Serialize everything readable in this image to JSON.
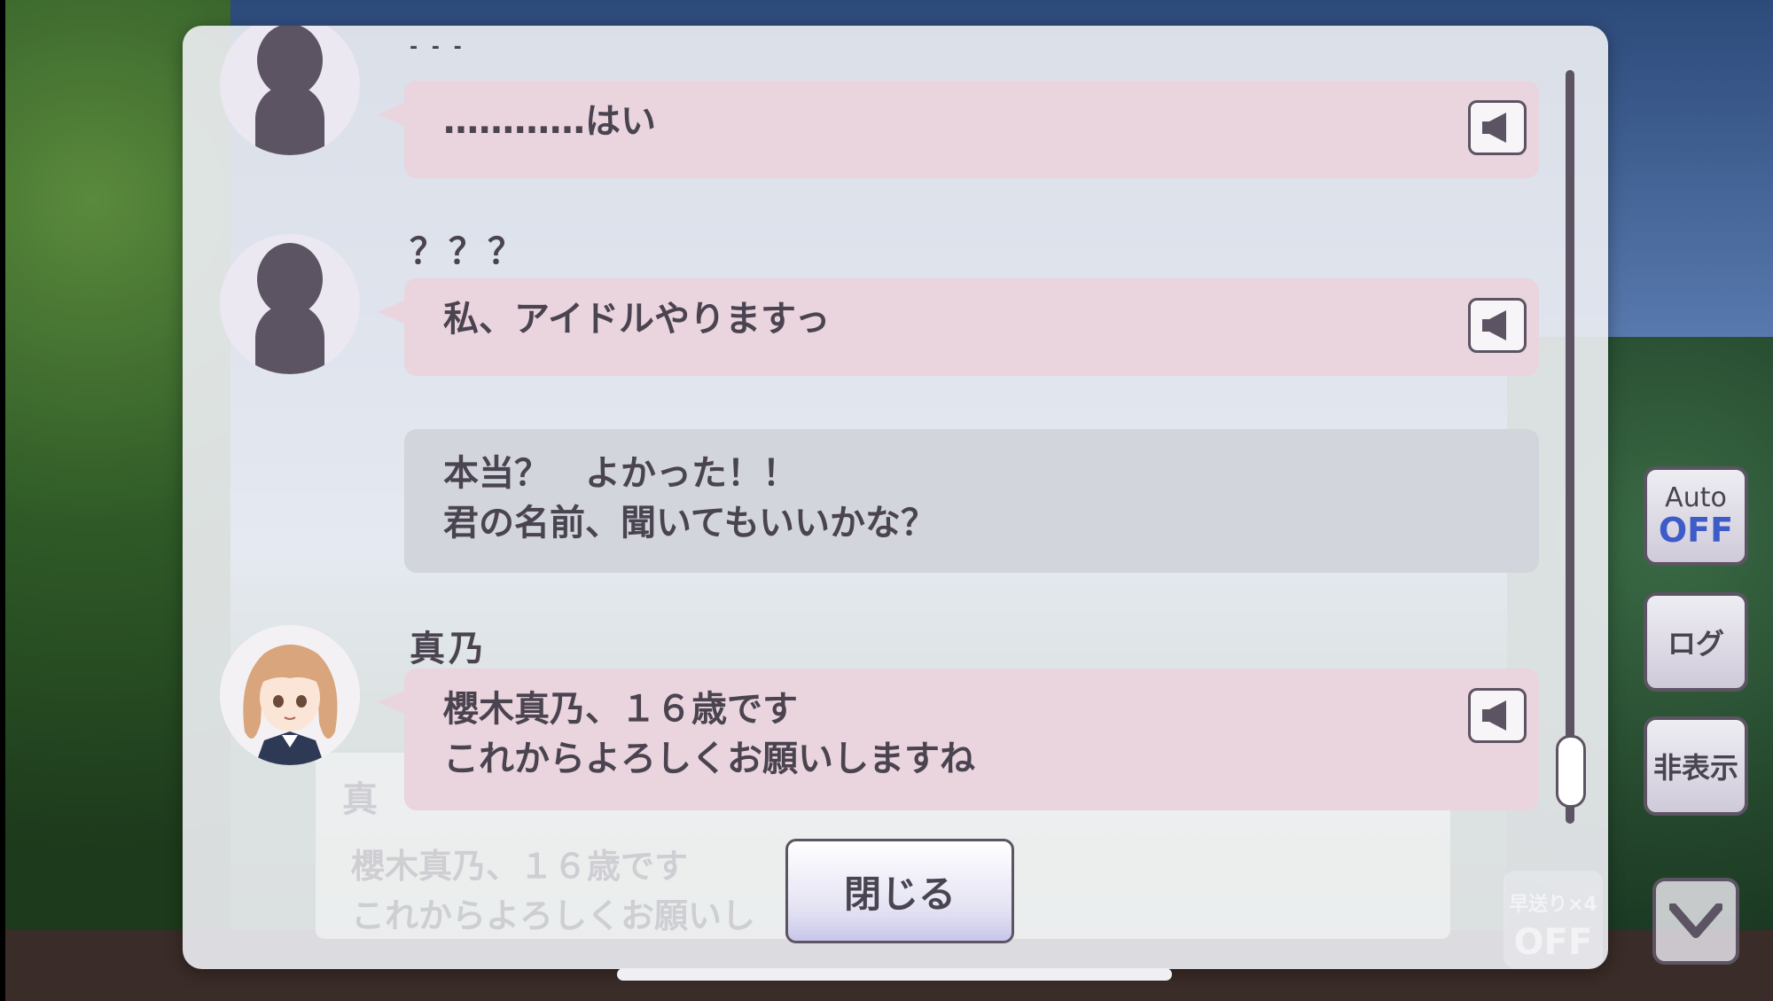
{
  "log": {
    "entries": [
      {
        "speaker": "- - -",
        "text": "…………はい",
        "has_voice": true,
        "avatar": "silhouette"
      },
      {
        "speaker": "？？？",
        "text": "私、アイドルやりますっ",
        "has_voice": true,
        "avatar": "silhouette"
      },
      {
        "speaker": "",
        "text_line1": "本当？　よかった！！",
        "text_line2": "君の名前、聞いてもいいかな？",
        "has_voice": false
      },
      {
        "speaker": "真乃",
        "text_line1": "櫻木真乃、１６歳です",
        "text_line2": "これからよろしくお願いしますね",
        "has_voice": true,
        "avatar": "mano"
      }
    ],
    "close_label": "閉じる"
  },
  "sidebar": {
    "auto_label": "Auto",
    "auto_state": "OFF",
    "log_label": "ログ",
    "hide_label": "非表示"
  },
  "background_dialog": {
    "name": "真",
    "line1": "櫻木真乃、１６歳です",
    "line2": "これからよろしくお願いし",
    "speed_label": "早送り×4",
    "speed_state": "OFF"
  },
  "colors": {
    "bubble_character": "#ead4de",
    "bubble_narration": "#d2d5dc",
    "outline": "#5d5463",
    "auto_off": "#3e5cc7"
  }
}
